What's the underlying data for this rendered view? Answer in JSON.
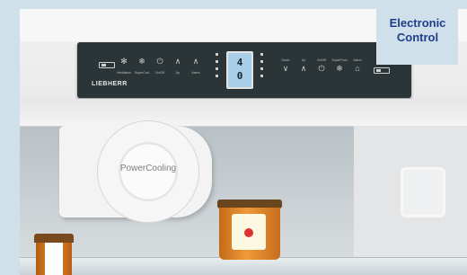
{
  "badge": {
    "line1": "Electronic",
    "line2": "Control"
  },
  "panel": {
    "brand": "LIEBHERR",
    "display": {
      "line1": "4",
      "line2": "0"
    },
    "left_buttons": [
      {
        "icon": "fan-icon",
        "glyph": "✻",
        "label": "Ventilation"
      },
      {
        "icon": "snowflake-icon",
        "glyph": "❄",
        "label": "SuperCool"
      },
      {
        "icon": "power-icon",
        "glyph": "⏻",
        "label": "On/Off"
      },
      {
        "icon": "up-icon",
        "glyph": "∧",
        "label": "Up"
      },
      {
        "icon": "alarm-icon",
        "glyph": "∧",
        "label": "Alarm"
      }
    ],
    "right_buttons": [
      {
        "icon": "down-icon",
        "glyph": "∨",
        "label": "Down"
      },
      {
        "icon": "up-icon",
        "glyph": "∧",
        "label": "Up"
      },
      {
        "icon": "power-icon",
        "glyph": "⏻",
        "label": "On/Off"
      },
      {
        "icon": "snowflake-icon",
        "glyph": "❄",
        "label": "SuperFrost"
      },
      {
        "icon": "alarm-icon",
        "glyph": "⌂",
        "label": "Alarm"
      }
    ]
  },
  "fan": {
    "label": "PowerCooling"
  },
  "colors": {
    "badge_text": "#1f3e8a",
    "panel": "#2b3436",
    "display": "#a9cfe8",
    "frame": "#cfe0ea"
  }
}
